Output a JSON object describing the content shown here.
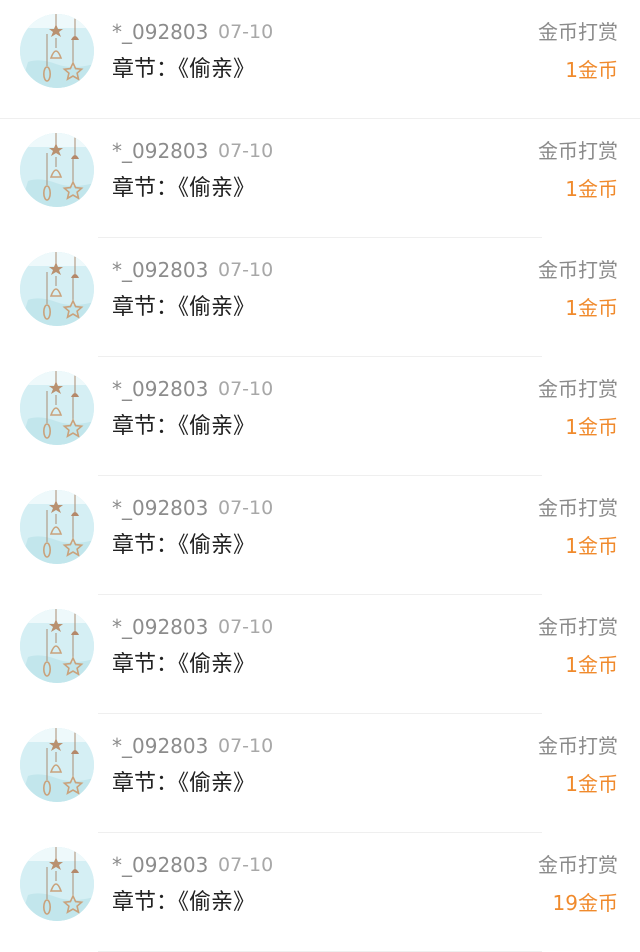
{
  "accent_color": "#f08a2c",
  "records": [
    {
      "user": "*_092803",
      "date": "07-10",
      "chapter_prefix": "章节：",
      "chapter_title": "《偷亲》",
      "reward_type": "金币打赏",
      "amount": "1金币"
    },
    {
      "user": "*_092803",
      "date": "07-10",
      "chapter_prefix": "章节：",
      "chapter_title": "《偷亲》",
      "reward_type": "金币打赏",
      "amount": "1金币"
    },
    {
      "user": "*_092803",
      "date": "07-10",
      "chapter_prefix": "章节：",
      "chapter_title": "《偷亲》",
      "reward_type": "金币打赏",
      "amount": "1金币"
    },
    {
      "user": "*_092803",
      "date": "07-10",
      "chapter_prefix": "章节：",
      "chapter_title": "《偷亲》",
      "reward_type": "金币打赏",
      "amount": "1金币"
    },
    {
      "user": "*_092803",
      "date": "07-10",
      "chapter_prefix": "章节：",
      "chapter_title": "《偷亲》",
      "reward_type": "金币打赏",
      "amount": "1金币"
    },
    {
      "user": "*_092803",
      "date": "07-10",
      "chapter_prefix": "章节：",
      "chapter_title": "《偷亲》",
      "reward_type": "金币打赏",
      "amount": "1金币"
    },
    {
      "user": "*_092803",
      "date": "07-10",
      "chapter_prefix": "章节：",
      "chapter_title": "《偷亲》",
      "reward_type": "金币打赏",
      "amount": "1金币"
    },
    {
      "user": "*_092803",
      "date": "07-10",
      "chapter_prefix": "章节：",
      "chapter_title": "《偷亲》",
      "reward_type": "金币打赏",
      "amount": "19金币"
    }
  ]
}
